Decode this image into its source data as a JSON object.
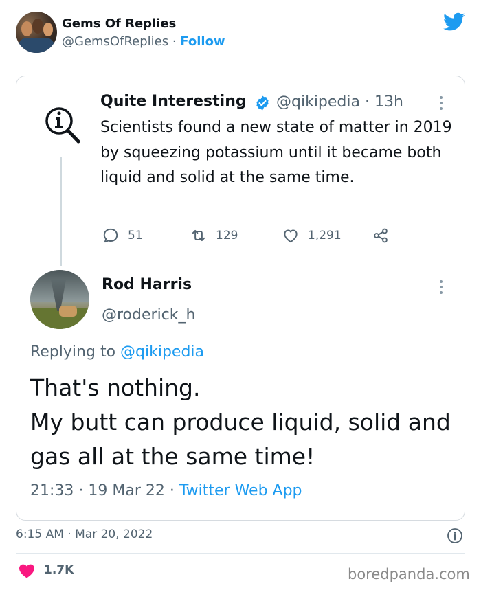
{
  "outer_tweet": {
    "display_name": "Gems Of Replies",
    "handle": "@GemsOfReplies",
    "separator": "·",
    "follow_label": "Follow",
    "timestamp": "6:15 AM · Mar 20, 2022",
    "like_count": "1.7K"
  },
  "quoted_tweet": {
    "display_name": "Quite Interesting",
    "handle_time": "@qikipedia · 13h",
    "text": "Scientists found a new state of matter in 2019 by squeezing potassium until it became both liquid and solid at the same time.",
    "replies": "51",
    "retweets": "129",
    "likes": "1,291"
  },
  "reply_tweet": {
    "display_name": "Rod Harris",
    "handle": "@roderick_h",
    "replying_prefix": "Replying to",
    "replying_to": "@qikipedia",
    "line1": "That's nothing.",
    "line2": "My butt can produce liquid, solid and gas all at the same time!",
    "time_date": "21:33 · 19 Mar 22 ·",
    "source": "Twitter Web App"
  },
  "watermark": "boredpanda.com",
  "colors": {
    "accent": "#1d9bf0",
    "heart": "#f91880",
    "secondary_text": "#536471"
  },
  "icons": [
    "twitter-bird-icon",
    "verified-badge-icon",
    "more-options-icon",
    "reply-icon",
    "retweet-icon",
    "like-icon",
    "share-icon",
    "info-icon",
    "heart-icon",
    "qi-magnifier-logo"
  ]
}
